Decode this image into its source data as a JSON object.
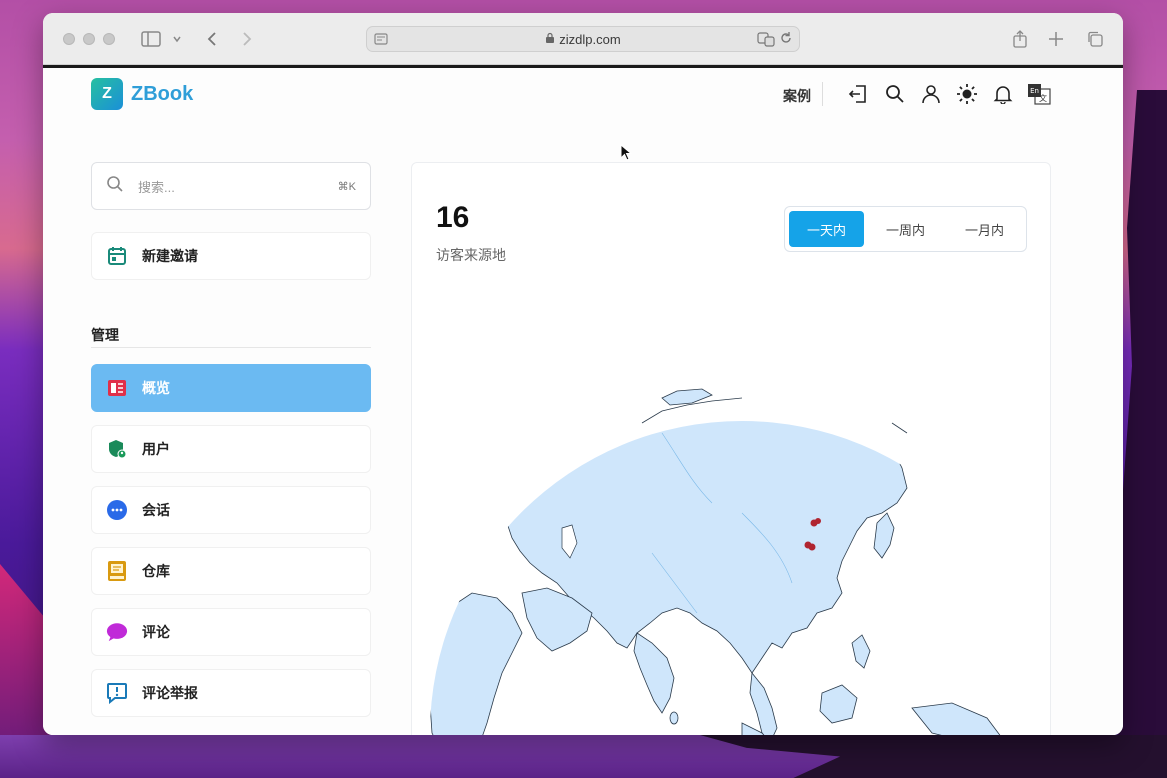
{
  "browser": {
    "url": "zizdlp.com"
  },
  "header": {
    "logo_text": "ZBook",
    "logo_mark": "Z",
    "nav_case": "案例",
    "icons": [
      "logout-icon",
      "search-icon",
      "user-icon",
      "sun-icon",
      "bell-icon",
      "language-icon"
    ]
  },
  "sidebar": {
    "search_placeholder": "搜索...",
    "search_shortcut": "⌘K",
    "new_invite": "新建邀请",
    "section_title": "管理",
    "items": [
      {
        "label": "概览",
        "icon": "overview-icon",
        "color": "#e0304a",
        "active": true
      },
      {
        "label": "用户",
        "icon": "user-shield-icon",
        "color": "#1a9a5a",
        "active": false
      },
      {
        "label": "会话",
        "icon": "chat-dots-icon",
        "color": "#2a6ae8",
        "active": false
      },
      {
        "label": "仓库",
        "icon": "book-icon",
        "color": "#d99a10",
        "active": false
      },
      {
        "label": "评论",
        "icon": "comment-icon",
        "color": "#c02ad8",
        "active": false
      },
      {
        "label": "评论举报",
        "icon": "report-icon",
        "color": "#1a7ab8",
        "active": false
      }
    ]
  },
  "main": {
    "visitor_count": "16",
    "visitor_label": "访客来源地",
    "range_tabs": [
      {
        "label": "一天内",
        "active": true
      },
      {
        "label": "一周内",
        "active": false
      },
      {
        "label": "一月内",
        "active": false
      }
    ]
  },
  "colors": {
    "accent": "#15a3e8",
    "active_sidebar": "#6bbaf2",
    "globe_land": "#cfe6fb",
    "visitor_marker": "#b02530"
  }
}
